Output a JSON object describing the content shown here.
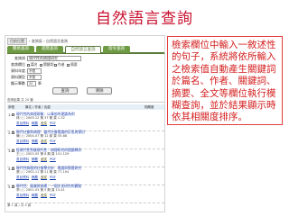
{
  "page": {
    "title": "自然語言查詢"
  },
  "panel": {
    "breadcrumb_home": "目前位置",
    "breadcrumb_path": "› 查詢區 › 自然語言查詢",
    "tabs": [
      "簡易查詢",
      "進階查詢",
      "自然語言查詢",
      "指令查詢"
    ],
    "active_tab": 2,
    "form": {
      "query_label": "查詢詞",
      "query_value": "現代性的病理研究",
      "fields_label": "查詢欄位",
      "fields": [
        "篇名",
        "關鍵詞",
        "作者",
        "摘要"
      ],
      "year_label": "資料年度",
      "year_value": "不限",
      "type_label": "資料類型",
      "type_value": "不限",
      "count_label": "顯示筆數",
      "count_value": "20",
      "count_unit": "筆"
    },
    "buttons": {
      "search": "查詢",
      "clear": "清除"
    },
    "results": {
      "summary": "查詢結果 共 20 筆",
      "columns": [
        "序號",
        "篇名 / 作者 / 出處",
        "相關度"
      ],
      "items": [
        {
          "num": "1.",
          "title": "現代性的病理現象：以韋伯的理論為例",
          "meta": "林○○ 2005-12 第 37 期 頁 1-32",
          "links": [
            "書目資料",
            "摘要",
            "全文",
            "PDF"
          ]
        },
        {
          "num": "2.",
          "title": "現代社會與病理：當代社會理論的反思與探討",
          "meta": "陳○○ 2004-07 第 12 卷 頁 55-88",
          "links": [
            "書目資料",
            "摘要",
            "全文",
            "PDF"
          ]
        },
        {
          "num": "3.",
          "title": "從現代性到後現代性：病理研究的理論轉折",
          "meta": "王○○ 2003-05 第 8 期 頁 101-129",
          "links": [
            "書目資料",
            "摘要",
            "全文",
            "PDF"
          ]
        },
        {
          "num": "4.",
          "title": "現代性病理的社會學分析：理論與實證研究",
          "meta": "張○○ 2002-11 第 21 期 頁 77-104",
          "links": [
            "書目資料",
            "摘要",
            "全文",
            "PDF"
          ]
        },
        {
          "num": "5.",
          "title": "現代性、風險與病理：一個文化研究的觀點",
          "meta": "李○○ 2001-03 第 5 期 頁 13-41",
          "links": [
            "書目資料",
            "摘要",
            "全文",
            "PDF"
          ]
        }
      ],
      "pager": "第 1 頁 / 共 4 頁"
    }
  },
  "callout": {
    "text": "檢索欄位中輸入一敘述性的句子，系統將依所輸入之檢索值自動產生關鍵詞於篇名、作者、關鍵詞、摘要、全文等欄位執行模糊查詢，並於結果顯示時依其相關度排序。"
  },
  "colors": {
    "title": "#c8102e",
    "callout_text": "#d42020",
    "callout_border": "#e23b3b",
    "tab_green": "#6f9a44",
    "link_blue": "#1a3fb0"
  }
}
